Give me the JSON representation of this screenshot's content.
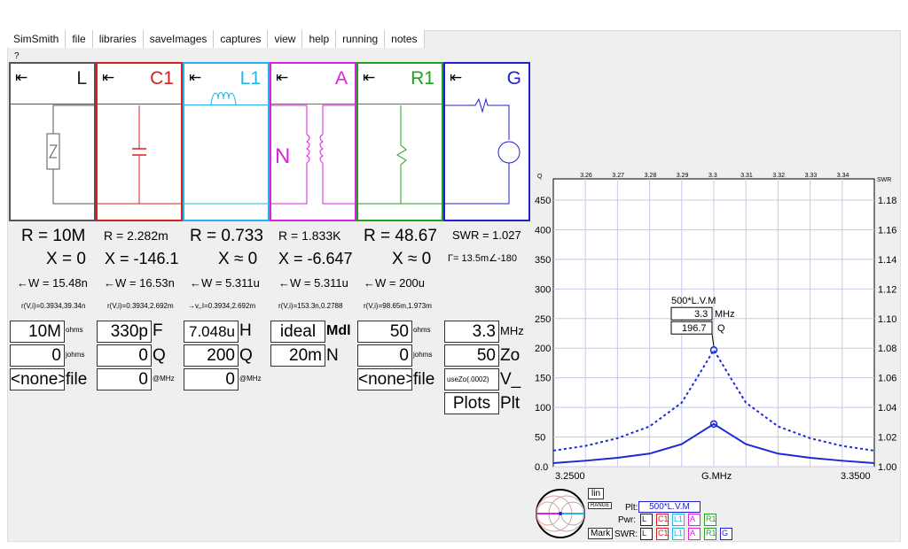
{
  "menu": [
    "SimSmith",
    "file",
    "libraries",
    "saveImages",
    "captures",
    "view",
    "help",
    "running",
    "notes"
  ],
  "help_mark": "?",
  "panels": [
    {
      "title": "L",
      "color": "#222222",
      "arrow": "⇤"
    },
    {
      "title": "C1",
      "color": "#d42020",
      "arrow": "⇤"
    },
    {
      "title": "L1",
      "color": "#20b8e8",
      "arrow": "⇤"
    },
    {
      "title": "A",
      "color": "#e020e0",
      "arrow": "⇤"
    },
    {
      "title": "R1",
      "color": "#20a020",
      "arrow": "⇤"
    },
    {
      "title": "G",
      "color": "#2020d0",
      "arrow": "⇤"
    }
  ],
  "readouts": {
    "r_L": "R = 10M",
    "r_C1": "R = 2.282m",
    "r_L1": "R = 0.733",
    "r_A": "R = 1.833K",
    "r_R1": "R = 48.67",
    "swr": "SWR = 1.027",
    "x_L": "X = 0",
    "x_C1": "X = -146.1",
    "x_L1": "X ≈ 0",
    "x_A": "X = -6.647",
    "x_R1": "X ≈ 0",
    "gamma": "Γ= 13.5m∠-180",
    "w_L": "←W = 15.48n",
    "w_C1": "←W = 16.53n",
    "w_L1": "←W = 5.311u",
    "w_A": "←W = 5.311u",
    "w_R1": "←W = 200u",
    "vi_L": "r(V,i)=0.3934,39.34n",
    "vi_C1": "r(V,i)=0.3934,2.692m",
    "vi_L1": "→v,,I=0.3934,2.692m",
    "vi_A": "r(V,i)=153.3n,0.2788",
    "vi_R1": "r(V,i)=98.65m,1.973m"
  },
  "fields": {
    "L": {
      "v1": "10M",
      "u1": "ohms",
      "v2": "0",
      "u2": "johms",
      "v3": "<none>",
      "u3": "file"
    },
    "C1": {
      "v1": "330p",
      "u1": "F",
      "v2": "0",
      "u2": "Q",
      "v3": "0",
      "u3": "@MHz"
    },
    "L1": {
      "v1": "7.048u",
      "u1": "H",
      "v2": "200",
      "u2": "Q",
      "v3": "0",
      "u3": "@MHz"
    },
    "A": {
      "v1": "ideal",
      "u1": "Mdl",
      "v2": "20m",
      "u2": "N"
    },
    "R1": {
      "v1": "50",
      "u1": "ohms",
      "v2": "0",
      "u2": "johms",
      "v3": "<none>",
      "u3": "file"
    },
    "G": {
      "v1": "3.3",
      "u1": "MHz",
      "v2": "50",
      "u2": "Zo",
      "v3": "useZo(.0002)",
      "u3": "V_",
      "v4": "Plots",
      "u4": "Plt"
    }
  },
  "chart_data": {
    "type": "line",
    "title": "",
    "xlabel": "G.MHz",
    "ylabel_left": "Q",
    "ylabel_right": "SWR",
    "xlim": [
      3.25,
      3.35
    ],
    "ylim_left": [
      0,
      450
    ],
    "ylim_right": [
      1.0,
      1.18
    ],
    "x_ticks_top": [
      "3.26",
      "3.27",
      "3.28",
      "3.29",
      "3.3",
      "3.31",
      "3.32",
      "3.33",
      "3.34"
    ],
    "x_ticks_bottom": [
      "3.2500",
      "3.3500"
    ],
    "y_ticks_left": [
      "0.0",
      "50",
      "100",
      "150",
      "200",
      "250",
      "300",
      "350",
      "400",
      "450"
    ],
    "y_ticks_right": [
      "1.00",
      "1.02",
      "1.04",
      "1.06",
      "1.08",
      "1.10",
      "1.12",
      "1.14",
      "1.16",
      "1.18"
    ],
    "grid": true,
    "marker": {
      "label": "500*L.V.M",
      "x": 3.3,
      "x_text": "3.3",
      "x_unit": "MHz",
      "y_text": "196.7",
      "y_unit": "Q"
    },
    "series": [
      {
        "style": "dashed",
        "color": "#1a2ad8",
        "x": [
          3.25,
          3.26,
          3.27,
          3.28,
          3.29,
          3.295,
          3.3,
          3.305,
          3.31,
          3.32,
          3.33,
          3.34,
          3.35
        ],
        "values": [
          27,
          35,
          48,
          68,
          108,
          152,
          197,
          152,
          108,
          68,
          48,
          35,
          27
        ]
      },
      {
        "style": "solid",
        "color": "#1a2ad8",
        "x": [
          3.25,
          3.26,
          3.27,
          3.28,
          3.29,
          3.295,
          3.3,
          3.305,
          3.31,
          3.32,
          3.33,
          3.34,
          3.35
        ],
        "values": [
          6,
          10,
          15,
          22,
          38,
          55,
          72,
          55,
          38,
          22,
          15,
          10,
          6
        ]
      }
    ]
  },
  "controls": {
    "lin_label": "lin",
    "range_label": "RANGE",
    "mark_label": "Mark",
    "plt_label": "Plt:",
    "plt_value": "500*L.V.M",
    "pwr_label": "Pwr:",
    "swr_label": "SWR:",
    "pwr_items": [
      "L",
      "C1",
      "L1",
      "A",
      "R1"
    ],
    "swr_items": [
      "L",
      "C1",
      "L1",
      "A",
      "R1",
      "G"
    ],
    "item_colors": [
      "#222222",
      "#d42020",
      "#20b8e8",
      "#e020e0",
      "#20a020",
      "#2020d0"
    ]
  }
}
